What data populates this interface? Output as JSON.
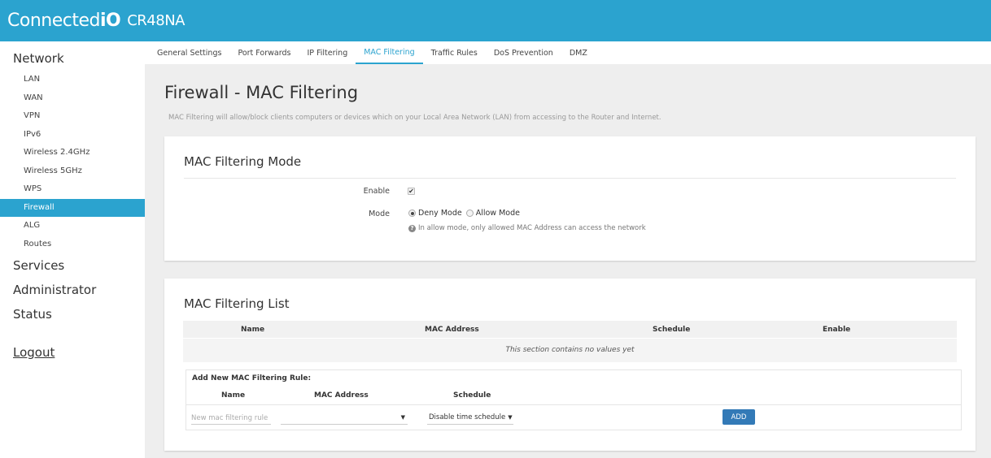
{
  "header": {
    "brand_light": "Connected",
    "brand_bold": "iO",
    "model": "CR48NA"
  },
  "sidebar": {
    "groups": [
      {
        "label": "Network"
      },
      {
        "label": "Services"
      },
      {
        "label": "Administrator"
      },
      {
        "label": "Status"
      }
    ],
    "network_items": [
      {
        "label": "LAN"
      },
      {
        "label": "WAN"
      },
      {
        "label": "VPN"
      },
      {
        "label": "IPv6"
      },
      {
        "label": "Wireless 2.4GHz"
      },
      {
        "label": "Wireless 5GHz"
      },
      {
        "label": "WPS"
      },
      {
        "label": "Firewall",
        "active": true
      },
      {
        "label": "ALG"
      },
      {
        "label": "Routes"
      }
    ],
    "logout": "Logout"
  },
  "tabs": [
    {
      "label": "General Settings"
    },
    {
      "label": "Port Forwards"
    },
    {
      "label": "IP Filtering"
    },
    {
      "label": "MAC Filtering",
      "active": true
    },
    {
      "label": "Traffic Rules"
    },
    {
      "label": "DoS Prevention"
    },
    {
      "label": "DMZ"
    }
  ],
  "page": {
    "title": "Firewall - MAC Filtering",
    "description": "MAC Filtering will allow/block clients computers or devices which on your Local Area Network (LAN) from accessing to the Router and Internet."
  },
  "mode_card": {
    "title": "MAC Filtering Mode",
    "enable_label": "Enable",
    "enable_checked": true,
    "mode_label": "Mode",
    "deny_label": "Deny Mode",
    "allow_label": "Allow Mode",
    "selected_mode": "deny",
    "help_text": "In allow mode, only allowed MAC Address can access the network"
  },
  "list_card": {
    "title": "MAC Filtering List",
    "columns": [
      "Name",
      "MAC Address",
      "Schedule",
      "Enable"
    ],
    "empty_text": "This section contains no values yet",
    "add": {
      "title": "Add New MAC Filtering Rule:",
      "columns": [
        "Name",
        "MAC Address",
        "Schedule"
      ],
      "name_placeholder": "New mac filtering rule",
      "mac_value": "",
      "schedule_value": "Disable time schedule",
      "button_label": "ADD"
    }
  },
  "colors": {
    "accent": "#2ba3cf",
    "button": "#337ab7"
  }
}
